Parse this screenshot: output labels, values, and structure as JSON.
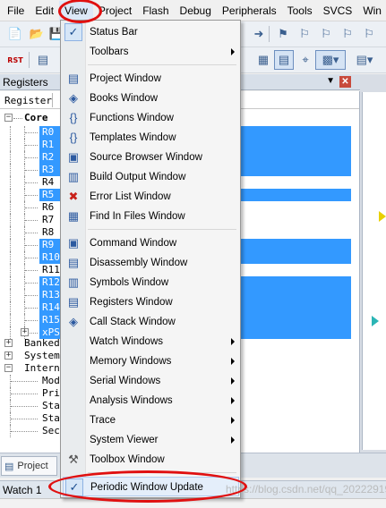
{
  "menubar": {
    "items": [
      "File",
      "Edit",
      "View",
      "Project",
      "Flash",
      "Debug",
      "Peripherals",
      "Tools",
      "SVCS",
      "Win"
    ],
    "active": "View"
  },
  "toolbar": {
    "rst_label": "RST"
  },
  "registers_panel": {
    "title": "Registers",
    "pin_icon": "pin-icon",
    "column_header": "Register",
    "groups": [
      {
        "label": "Core",
        "expanded": true
      },
      {
        "label": "Banked",
        "expanded": false
      },
      {
        "label": "System",
        "expanded": false
      },
      {
        "label": "Interne",
        "expanded": true
      }
    ],
    "core_registers": [
      {
        "name": "R0",
        "highlighted": true
      },
      {
        "name": "R1",
        "highlighted": true
      },
      {
        "name": "R2",
        "highlighted": true
      },
      {
        "name": "R3",
        "highlighted": true
      },
      {
        "name": "R4",
        "highlighted": false
      },
      {
        "name": "R5",
        "highlighted": true
      },
      {
        "name": "R6",
        "highlighted": false
      },
      {
        "name": "R7",
        "highlighted": false
      },
      {
        "name": "R8",
        "highlighted": false
      },
      {
        "name": "R9",
        "highlighted": true
      },
      {
        "name": "R10",
        "highlighted": true
      },
      {
        "name": "R11",
        "highlighted": false
      },
      {
        "name": "R12",
        "highlighted": true
      },
      {
        "name": "R13",
        "highlighted": true
      },
      {
        "name": "R14",
        "highlighted": true
      },
      {
        "name": "R15",
        "highlighted": true
      },
      {
        "name": "xPSI",
        "highlighted": true
      }
    ],
    "internal_items": [
      "Mod",
      "Pri",
      "Sta",
      "Sta",
      "Sec"
    ]
  },
  "view_menu": {
    "items": [
      {
        "label": "Status Bar",
        "checked": true,
        "icon": null,
        "submenu": false
      },
      {
        "label": "Toolbars",
        "checked": false,
        "icon": null,
        "submenu": true
      },
      {
        "separator": true
      },
      {
        "label": "Project Window",
        "icon": "project-window-icon",
        "submenu": false
      },
      {
        "label": "Books Window",
        "icon": "books-icon",
        "submenu": false
      },
      {
        "label": "Functions Window",
        "icon": "braces-icon",
        "submenu": false
      },
      {
        "label": "Templates Window",
        "icon": "templates-icon",
        "submenu": false
      },
      {
        "label": "Source Browser Window",
        "icon": "source-browser-icon",
        "submenu": false
      },
      {
        "label": "Build Output Window",
        "icon": "build-output-icon",
        "submenu": false
      },
      {
        "label": "Error List Window",
        "icon": "error-x-icon",
        "submenu": false
      },
      {
        "label": "Find In Files Window",
        "icon": "find-in-files-icon",
        "submenu": false
      },
      {
        "separator": true
      },
      {
        "label": "Command Window",
        "icon": "command-icon",
        "submenu": false
      },
      {
        "label": "Disassembly Window",
        "icon": "disassembly-icon",
        "submenu": false
      },
      {
        "label": "Symbols Window",
        "icon": "symbols-icon",
        "submenu": false
      },
      {
        "label": "Registers Window",
        "icon": "registers-icon",
        "submenu": false
      },
      {
        "label": "Call Stack Window",
        "icon": "call-stack-icon",
        "submenu": false
      },
      {
        "label": "Watch Windows",
        "icon": null,
        "submenu": true
      },
      {
        "label": "Memory Windows",
        "icon": null,
        "submenu": true
      },
      {
        "label": "Serial Windows",
        "icon": null,
        "submenu": true
      },
      {
        "label": "Analysis Windows",
        "icon": null,
        "submenu": true
      },
      {
        "label": "Trace",
        "icon": null,
        "submenu": true
      },
      {
        "label": "System Viewer",
        "icon": null,
        "submenu": true
      },
      {
        "label": "Toolbox Window",
        "icon": "toolbox-icon",
        "submenu": false
      },
      {
        "separator": true
      },
      {
        "label": "Periodic Window Update",
        "checked": true,
        "highlighted": true,
        "submenu": false
      }
    ]
  },
  "bottom": {
    "project_tab": "Project",
    "watch_label": "Watch 1"
  },
  "watermark": "https://blog.csdn.net/qq_20222919",
  "colors": {
    "selection_blue": "#3399ff",
    "annotation_red": "#e01010",
    "menu_highlight": "#e4eefa"
  }
}
